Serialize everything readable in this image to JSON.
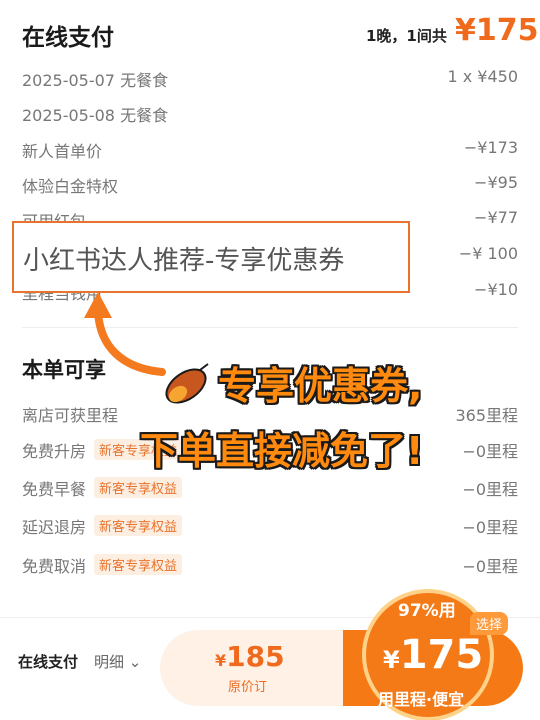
{
  "header": {
    "title": "在线支付",
    "stay_desc": "1晚，1间共",
    "total_price": "¥175"
  },
  "price_rows": [
    {
      "label": "2025-05-07 无餐食",
      "value": "1 x ¥450"
    },
    {
      "label": "2025-05-08 无餐食",
      "value": ""
    },
    {
      "label": "新人首单价",
      "value": "−¥173"
    },
    {
      "label": "体验白金特权",
      "value": "−¥95"
    },
    {
      "label": "可用红包",
      "value": "−¥77"
    },
    {
      "label": "",
      "value": "−¥ 100"
    },
    {
      "label": "里程当钱用",
      "value": "−¥10"
    }
  ],
  "overlay": {
    "banner": "小红书达人推荐-专享优惠券",
    "promo_line1": "专享优惠券,",
    "promo_line2": "下单直接减免了!",
    "potato_icon": "sweet-potato-icon",
    "arrow_color": "#f47a20"
  },
  "benefits": {
    "title": "本单可享",
    "rows": [
      {
        "label": "离店可获里程",
        "badge": "",
        "value": "365里程"
      },
      {
        "label": "免费升房",
        "badge": "新客专享权益",
        "value": "−0里程"
      },
      {
        "label": "免费早餐",
        "badge": "新客专享权益",
        "value": "−0里程"
      },
      {
        "label": "延迟退房",
        "badge": "新客专享权益",
        "value": "−0里程"
      },
      {
        "label": "免费取消",
        "badge": "新客专享权益",
        "value": "−0里程"
      }
    ]
  },
  "bottom_bar": {
    "pay_label": "在线支付",
    "detail_link": "明细",
    "orig_currency": "¥",
    "orig_amount": "185",
    "orig_label": "原价订",
    "badge_percent": "97%用",
    "badge_choose": "选择",
    "deal_currency": "¥",
    "deal_amount": "175",
    "deal_label": "用里程·便宜"
  },
  "colors": {
    "accent": "#f06a1d",
    "button": "#f57a15",
    "badge_bg": "#fdeee2",
    "promo_text": "#ff8a0d"
  }
}
